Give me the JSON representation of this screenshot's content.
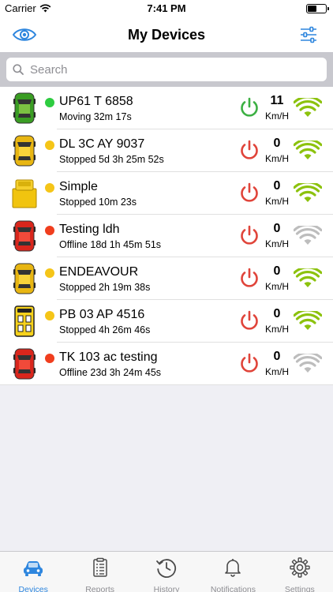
{
  "status_bar": {
    "carrier": "Carrier",
    "time": "7:41 PM"
  },
  "nav": {
    "title": "My Devices",
    "left_icon": "eye-icon",
    "right_icon": "filter-sliders-icon"
  },
  "search": {
    "placeholder": "Search",
    "value": ""
  },
  "colors": {
    "accent": "#2e86de",
    "online": "#2ecc40",
    "idle": "#f5c518",
    "offline": "#f03e1e",
    "power_on": "#3cb043",
    "power_off": "#e0443a",
    "signal_good": "#8cc20d",
    "signal_bad": "#bdbdbd"
  },
  "devices": [
    {
      "name": "UP61 T 6858",
      "status": "Moving 32m 17s",
      "state": "moving",
      "vehicle": "car-green",
      "ignition": "on",
      "speed": "11",
      "unit": "Km/H",
      "signal": "good"
    },
    {
      "name": "DL 3C AY 9037",
      "status": "Stopped 5d 3h 25m 52s",
      "state": "stopped",
      "vehicle": "car-yellow",
      "ignition": "off",
      "speed": "0",
      "unit": "Km/H",
      "signal": "good"
    },
    {
      "name": "Simple",
      "status": "Stopped 10m 23s",
      "state": "stopped",
      "vehicle": "truck-yellow",
      "ignition": "off",
      "speed": "0",
      "unit": "Km/H",
      "signal": "good"
    },
    {
      "name": "Testing ldh",
      "status": "Offline 18d 1h 45m 51s",
      "state": "offline",
      "vehicle": "car-red",
      "ignition": "off",
      "speed": "0",
      "unit": "Km/H",
      "signal": "bad"
    },
    {
      "name": "ENDEAVOUR",
      "status": "Stopped 2h 19m 38s",
      "state": "stopped",
      "vehicle": "car-yellow",
      "ignition": "off",
      "speed": "0",
      "unit": "Km/H",
      "signal": "good"
    },
    {
      "name": "PB 03 AP 4516",
      "status": "Stopped 4h 26m 46s",
      "state": "stopped",
      "vehicle": "bus-yellow",
      "ignition": "off",
      "speed": "0",
      "unit": "Km/H",
      "signal": "good"
    },
    {
      "name": "TK 103 ac testing",
      "status": "Offline 23d 3h 24m 45s",
      "state": "offline",
      "vehicle": "car-red",
      "ignition": "off",
      "speed": "0",
      "unit": "Km/H",
      "signal": "bad"
    }
  ],
  "tabs": [
    {
      "label": "Devices",
      "icon": "car-icon",
      "active": true
    },
    {
      "label": "Reports",
      "icon": "clipboard-icon",
      "active": false
    },
    {
      "label": "History",
      "icon": "history-clock-icon",
      "active": false
    },
    {
      "label": "Notifications",
      "icon": "bell-icon",
      "active": false
    },
    {
      "label": "Settings",
      "icon": "gear-icon",
      "active": false
    }
  ]
}
